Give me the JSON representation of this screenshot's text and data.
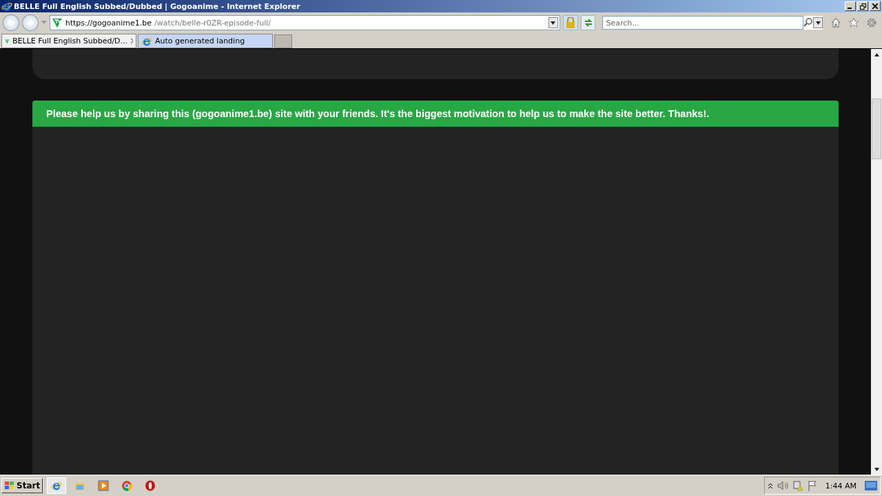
{
  "window": {
    "title": "BELLE Full English Subbed/Dubbed | Gogoanime - Internet Explorer"
  },
  "address": {
    "host": "https://gogoanime1.be",
    "path": "/watch/belle-r0ZR-episode-full/"
  },
  "search": {
    "placeholder": "Search..."
  },
  "tabs": [
    {
      "label": "BELLE Full English Subbed/D...",
      "selected": true,
      "kind": "site"
    },
    {
      "label": "Auto generated landing",
      "selected": false,
      "kind": "ie"
    }
  ],
  "page": {
    "banner": "Please help us by sharing this (gogoanime1.be) site with your friends. It's the biggest motivation to help us to make the site better. Thanks!."
  },
  "taskbar": {
    "start": "Start",
    "clock": "1:44 AM"
  }
}
